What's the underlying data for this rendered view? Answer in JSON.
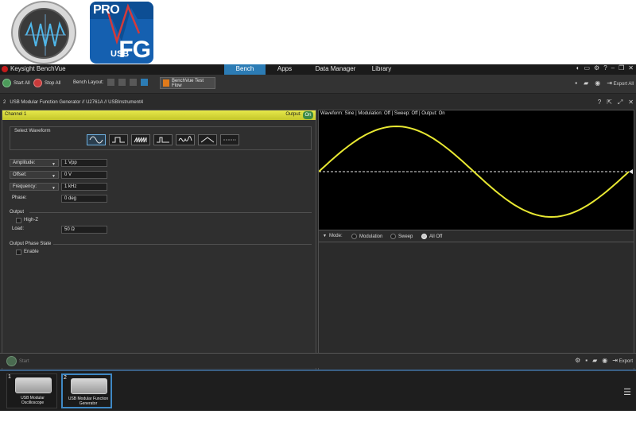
{
  "logos": {
    "oscilloscope": "oscilloscope-app-icon",
    "fg_pro": "PRO",
    "fg_usb": "USB",
    "fg_fg": "FG"
  },
  "app": {
    "title": "Keysight BenchVue",
    "tabs": [
      {
        "label": "Bench",
        "active": true
      },
      {
        "label": "Apps",
        "active": false
      },
      {
        "label": "Data Manager",
        "active": false
      },
      {
        "label": "Library",
        "active": false
      }
    ],
    "window_icons": [
      "notifications-icon",
      "chat-icon",
      "settings-icon",
      "help-icon",
      "minimize-icon",
      "restore-icon",
      "close-icon"
    ]
  },
  "toolbar": {
    "start_all": "Start All",
    "stop_all": "Stop All",
    "bench_layout": "Bench Layout:",
    "test_flow": "BenchVue Test Flow",
    "export_all": "Export All"
  },
  "instrument": {
    "number": "2",
    "name": "USB Modular Function Generator // U2761A // USBInstrument4"
  },
  "channel": {
    "name": "Channel 1",
    "output_label": "Output:",
    "output_state": "On"
  },
  "waveform": {
    "group_label": "Select Waveform",
    "options": [
      "sine",
      "square",
      "ramp",
      "pulse",
      "arbitrary",
      "triangle",
      "dc"
    ],
    "selected": "sine"
  },
  "params": {
    "amplitude_label": "Amplitude:",
    "amplitude_value": "1 Vpp",
    "offset_label": "Offset:",
    "offset_value": "0 V",
    "frequency_label": "Frequency:",
    "frequency_value": "1 kHz",
    "phase_label": "Phase:",
    "phase_value": "0 deg"
  },
  "output": {
    "section_label": "Output",
    "highz_label": "High-Z",
    "load_label": "Load:",
    "load_value": "50 Ω"
  },
  "phase_state": {
    "section_label": "Output Phase State",
    "enable_label": "Enable"
  },
  "plot": {
    "status": "Waveform: Sine | Modulation: Off | Sweep: Off | Output: On",
    "trace_color": "#e8e832"
  },
  "mode": {
    "label": "Mode:",
    "options": [
      {
        "label": "Modulation",
        "selected": false
      },
      {
        "label": "Sweep",
        "selected": false
      },
      {
        "label": "All Off",
        "selected": true
      }
    ]
  },
  "bottom": {
    "start": "Start",
    "export": "Export"
  },
  "thumbnails": [
    {
      "num": "1",
      "caption_line1": "USB Modular",
      "caption_line2": "Oscilloscope",
      "selected": false
    },
    {
      "num": "2",
      "caption_line1": "USB Modular Function",
      "caption_line2": "Generator",
      "selected": true
    }
  ]
}
